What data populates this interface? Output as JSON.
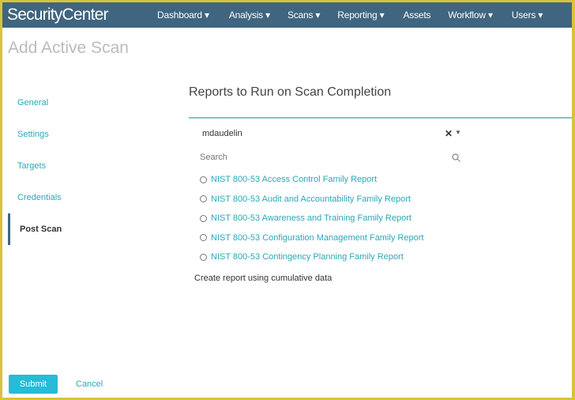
{
  "app": {
    "logo": "SecurityCenter"
  },
  "nav": [
    {
      "label": "Dashboard",
      "dropdown": true
    },
    {
      "label": "Analysis",
      "dropdown": true
    },
    {
      "label": "Scans",
      "dropdown": true
    },
    {
      "label": "Reporting",
      "dropdown": true
    },
    {
      "label": "Assets",
      "dropdown": false
    },
    {
      "label": "Workflow",
      "dropdown": true
    },
    {
      "label": "Users",
      "dropdown": true
    }
  ],
  "page_title": "Add Active Scan",
  "sidebar": {
    "items": [
      {
        "label": "General"
      },
      {
        "label": "Settings"
      },
      {
        "label": "Targets"
      },
      {
        "label": "Credentials"
      },
      {
        "label": "Post Scan",
        "active": true
      }
    ]
  },
  "main": {
    "heading": "Reports to Run on Scan Completion",
    "owner_select": {
      "value": "mdaudelin"
    },
    "search": {
      "placeholder": "Search"
    },
    "reports": [
      "NIST 800-53 Access Control Family Report",
      "NIST 800-53 Audit and Accountability Family Report",
      "NIST 800-53 Awareness and Training Family Report",
      "NIST 800-53 Configuration Management Family Report",
      "NIST 800-53 Contingency Planning Family Report"
    ],
    "cumulative_label": "Create report using cumulative data"
  },
  "footer": {
    "submit": "Submit",
    "cancel": "Cancel"
  },
  "colors": {
    "nav": "#3f6580",
    "accent": "#2aa8b8",
    "submit": "#25bcd6"
  }
}
